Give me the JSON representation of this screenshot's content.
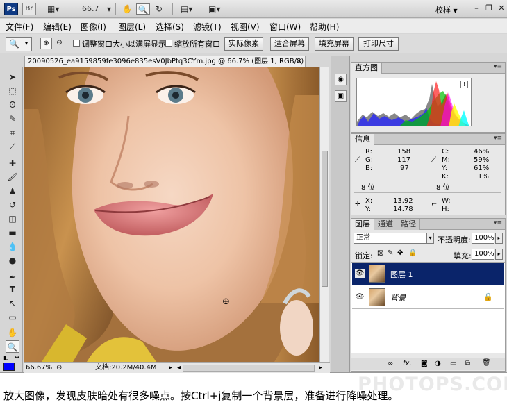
{
  "appbar": {
    "ps_label": "Ps",
    "br_label": "Br",
    "zoom_value": "66.7",
    "workspace": "校样",
    "workspace_arrow": "▼"
  },
  "menu": [
    "文件(F)",
    "编辑(E)",
    "图像(I)",
    "图层(L)",
    "选择(S)",
    "滤镜(T)",
    "视图(V)",
    "窗口(W)",
    "帮助(H)"
  ],
  "options": {
    "resize_windows_label": "调整窗口大小以满屏显示",
    "zoom_all_label": "缩放所有窗口",
    "actual_pixels": "实际像素",
    "fit_screen": "适合屏幕",
    "fill_screen": "填充屏幕",
    "print_size": "打印尺寸"
  },
  "document": {
    "tab_title": "20090526_ea9159859fe3096e835esV0JbPtq3CYm.jpg @ 66.7% (图层 1, RGB/8) *",
    "close": "×",
    "zoom_percent": "66.67%",
    "doc_size": "文档:20.2M/40.4M"
  },
  "histogram": {
    "tab": "直方图",
    "warning": "!"
  },
  "info": {
    "tab": "信息",
    "r_label": "R:",
    "r_value": "158",
    "g_label": "G:",
    "g_value": "117",
    "b_label": "B:",
    "b_value": "97",
    "bits_left": "8 位",
    "c_label": "C:",
    "c_value": "46%",
    "m_label": "M:",
    "m_value": "59%",
    "y_label": "Y:",
    "y_value": "61%",
    "k_label": "K:",
    "k_value": "1%",
    "bits_right": "8 位",
    "x_label": "X:",
    "x_value": "13.92",
    "yc_label": "Y:",
    "yc_value": "14.78",
    "w_label": "W:",
    "h_label": "H:"
  },
  "layers": {
    "tabs": [
      "图层",
      "通道",
      "路径"
    ],
    "blend_mode": "正常",
    "opacity_label": "不透明度:",
    "opacity_value": "100%",
    "lock_label": "锁定:",
    "fill_label": "填充:",
    "fill_value": "100%",
    "items": [
      {
        "name": "图层 1",
        "selected": true
      },
      {
        "name": "背景",
        "selected": false
      }
    ],
    "bottom_icons": [
      "∞",
      "fx.",
      "◙",
      "◑",
      "▭",
      "⧉",
      "🗑"
    ]
  },
  "caption": "放大图像，发现皮肤暗处有很多噪点。按Ctrl+j复制一个背景层，准备进行降噪处理。",
  "watermark": "PHOTOPS.COM",
  "colors": {
    "foreground": "#0000ff",
    "selected_layer": "#0a246a"
  }
}
